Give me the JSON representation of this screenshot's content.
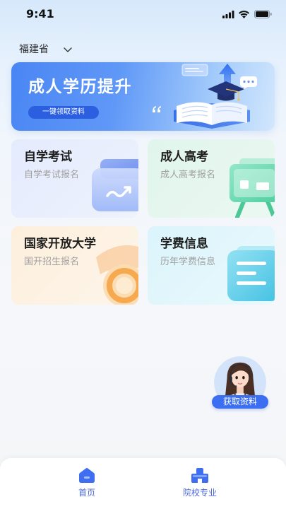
{
  "status_bar": {
    "time": "9:41",
    "icons": [
      "cellular-signal-icon",
      "wifi-icon",
      "battery-icon"
    ]
  },
  "location": {
    "label": "福建省",
    "icon": "chevron-down-icon"
  },
  "banner": {
    "title": "成人学历提升",
    "button_label": "一键领取资料",
    "illustration": "book-graduation-cap-illustration"
  },
  "cards": [
    {
      "title": "自学考试",
      "subtitle": "自学考试报名",
      "icon": "trend-chart-icon"
    },
    {
      "title": "成人高考",
      "subtitle": "成人高考报名",
      "icon": "presentation-easel-icon"
    },
    {
      "title": "国家开放大学",
      "subtitle": "国开招生报名",
      "icon": "graduation-cap-icon"
    },
    {
      "title": "学费信息",
      "subtitle": "历年学费信息",
      "icon": "document-icon"
    }
  ],
  "floating_assistant": {
    "label": "获取资料",
    "avatar": "customer-service-avatar"
  },
  "tab_bar": {
    "items": [
      {
        "label": "首页",
        "icon": "home-icon"
      },
      {
        "label": "院校专业",
        "icon": "school-icon"
      }
    ]
  },
  "colors": {
    "accent": "#3b6ef0",
    "accent_dark": "#2b5fe0",
    "banner_start": "#4a86f4",
    "banner_end": "#d2e7fd",
    "card_blue": "#e4ebfd",
    "card_green": "#e0f5ec",
    "card_orange": "#fdefdc",
    "card_cyan": "#dbf4fb",
    "tab_text": "#4a67d6"
  }
}
